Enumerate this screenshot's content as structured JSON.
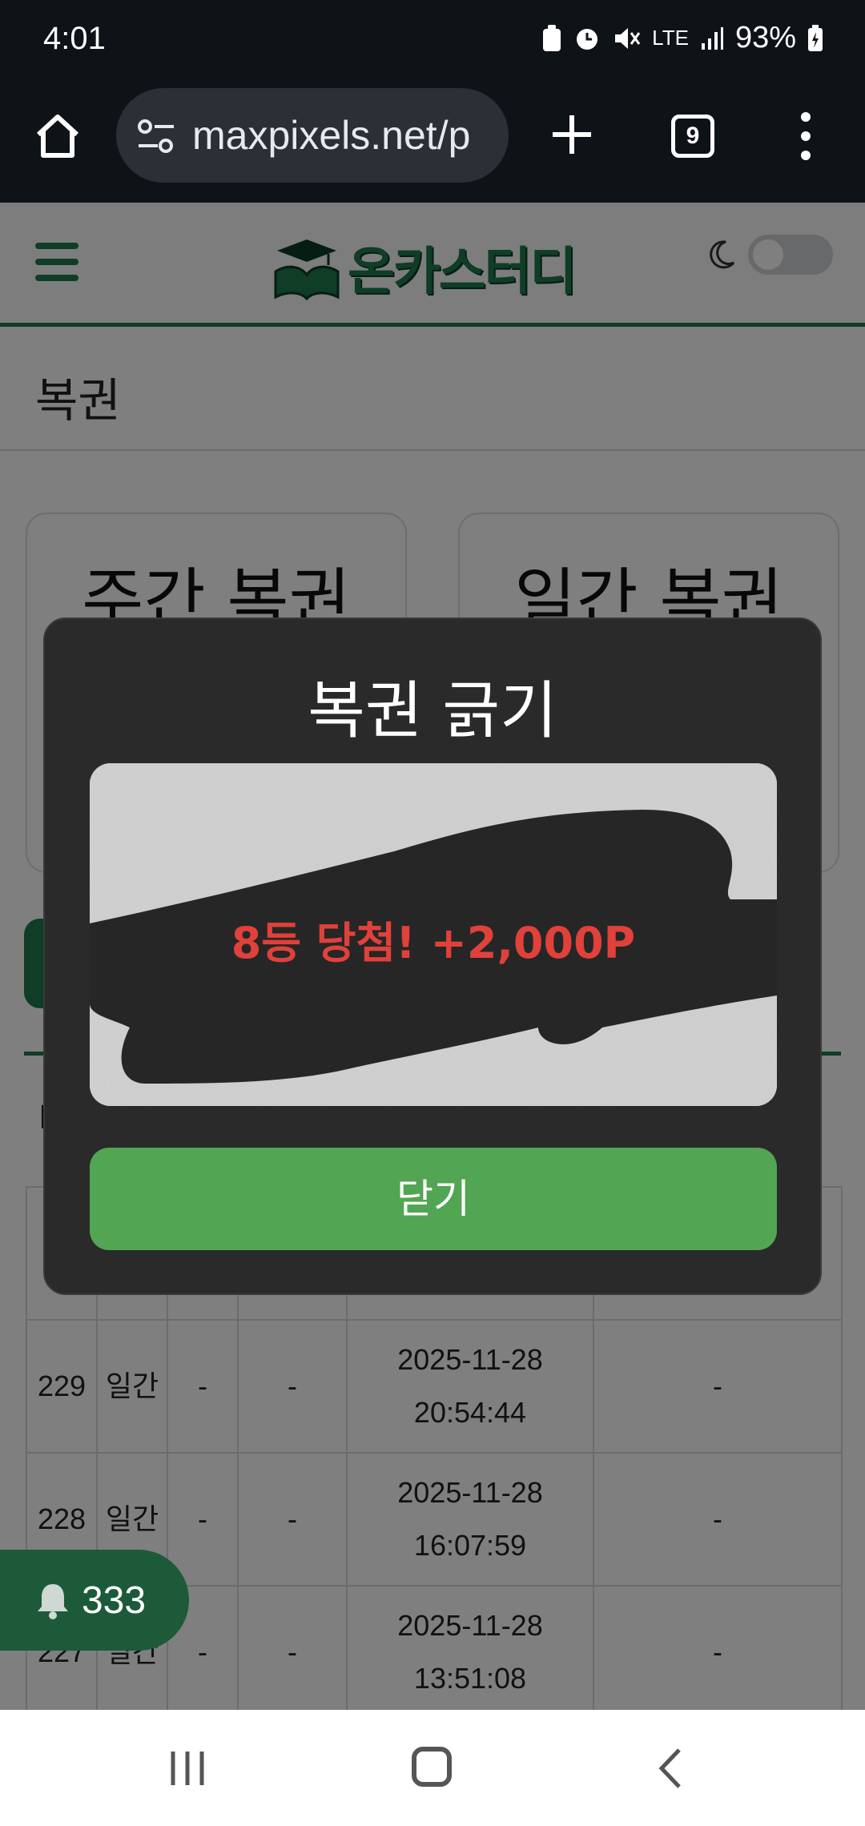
{
  "status_bar": {
    "time": "4:01",
    "network": "LTE",
    "battery": "93%"
  },
  "browser": {
    "url": "maxpixels.net/p",
    "tab_count": "9"
  },
  "site": {
    "brand": "온카스터디",
    "page_title": "복권",
    "cards": [
      {
        "title": "주간 복권"
      },
      {
        "title": "일간 복권"
      }
    ],
    "partial_label": "I",
    "history": [
      {
        "id": "229",
        "kind": "일간",
        "c3": "-",
        "c4": "-",
        "date": "2025-11-28",
        "time": "20:54:44",
        "c6": "-"
      },
      {
        "id": "228",
        "kind": "일간",
        "c3": "-",
        "c4": "-",
        "date": "2025-11-28",
        "time": "16:07:59",
        "c6": "-"
      },
      {
        "id": "227",
        "kind": "일간",
        "c3": "-",
        "c4": "-",
        "date": "2025-11-28",
        "time": "13:51:08",
        "c6": "-"
      }
    ],
    "notification_count": "333"
  },
  "modal": {
    "title": "복권 긁기",
    "prize": "8등 당첨! +2,000P",
    "close_label": "닫기"
  },
  "colors": {
    "brand_green": "#1f7a4c",
    "button_green": "#52a552",
    "prize_red": "#e0413a",
    "modal_bg": "#2a2a2a"
  }
}
